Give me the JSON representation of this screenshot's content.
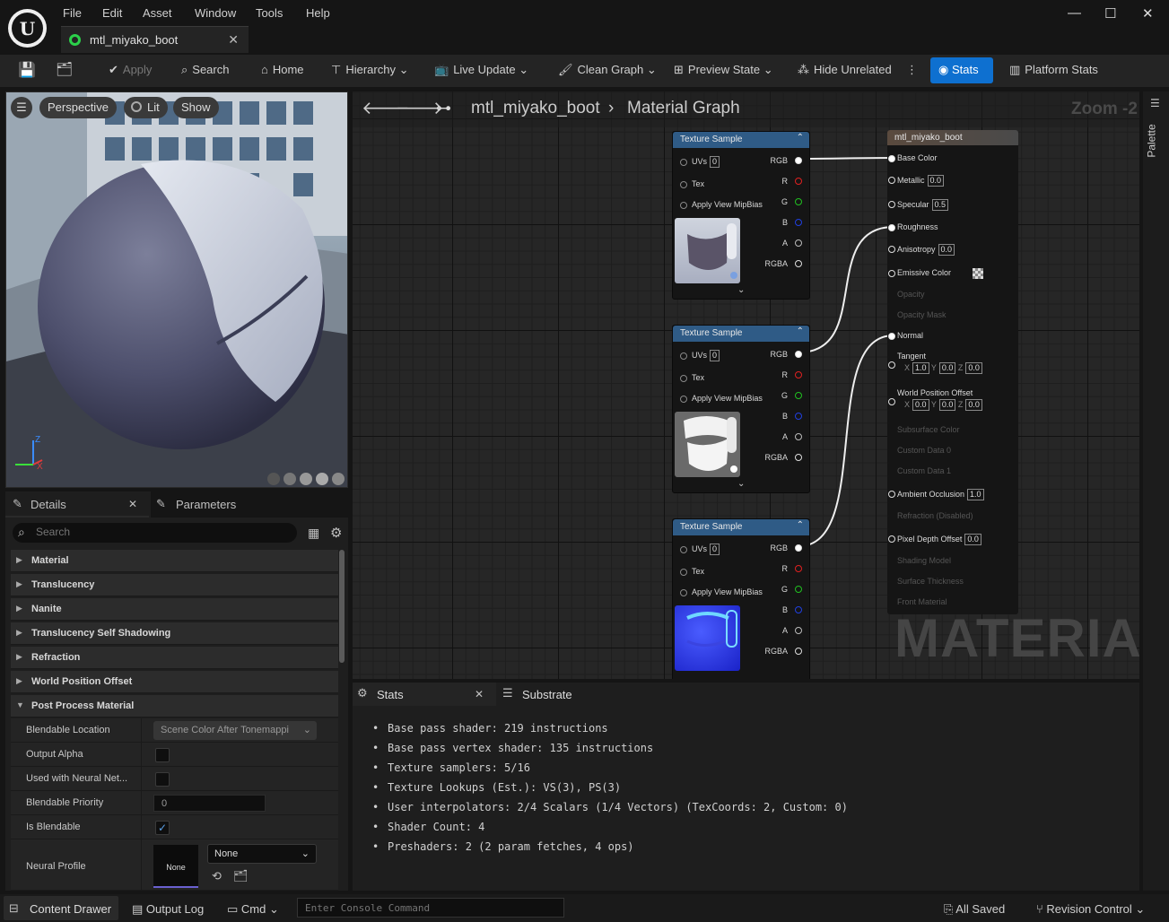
{
  "menu": [
    "File",
    "Edit",
    "Asset",
    "Window",
    "Tools",
    "Help"
  ],
  "document_tab": "mtl_miyako_boot",
  "toolbar": {
    "apply": "Apply",
    "search": "Search",
    "home": "Home",
    "hierarchy": "Hierarchy",
    "live_update": "Live Update",
    "clean_graph": "Clean Graph",
    "preview_state": "Preview State",
    "hide_unrelated": "Hide Unrelated",
    "stats": "Stats",
    "platform_stats": "Platform Stats"
  },
  "viewport": {
    "perspective": "Perspective",
    "lit": "Lit",
    "show": "Show",
    "axis_z": "Z",
    "axis_x": "X"
  },
  "details": {
    "tab_details": "Details",
    "tab_parameters": "Parameters",
    "search_placeholder": "Search",
    "sections": [
      "Material",
      "Translucency",
      "Nanite",
      "Translucency Self Shadowing",
      "Refraction",
      "World Position Offset",
      "Post Process Material"
    ],
    "post_process": {
      "blendable_location_label": "Blendable Location",
      "blendable_location_value": "Scene Color After Tonemappi",
      "output_alpha_label": "Output Alpha",
      "neural_net_label": "Used with Neural Net...",
      "blendable_priority_label": "Blendable Priority",
      "blendable_priority_value": "0",
      "is_blendable_label": "Is Blendable",
      "neural_profile_label": "Neural Profile",
      "neural_profile_thumb": "None",
      "neural_profile_value": "None"
    }
  },
  "graph": {
    "breadcrumb_asset": "mtl_miyako_boot",
    "breadcrumb_graph": "Material Graph",
    "zoom": "Zoom -2",
    "watermark": "MATERIAL",
    "texture_nodes": [
      {
        "title": "Texture Sample",
        "uvs": "UVs",
        "uv_val": "0",
        "tex": "Tex",
        "mip": "Apply View MipBias",
        "outputs": [
          "RGB",
          "R",
          "G",
          "B",
          "A",
          "RGBA"
        ]
      },
      {
        "title": "Texture Sample",
        "uvs": "UVs",
        "uv_val": "0",
        "tex": "Tex",
        "mip": "Apply View MipBias",
        "outputs": [
          "RGB",
          "R",
          "G",
          "B",
          "A",
          "RGBA"
        ]
      },
      {
        "title": "Texture Sample",
        "uvs": "UVs",
        "uv_val": "0",
        "tex": "Tex",
        "mip": "Apply View MipBias",
        "outputs": [
          "RGB",
          "R",
          "G",
          "B",
          "A",
          "RGBA"
        ]
      }
    ],
    "material_node": {
      "title": "mtl_miyako_boot",
      "base_color": "Base Color",
      "metallic": "Metallic",
      "metallic_val": "0.0",
      "specular": "Specular",
      "specular_val": "0.5",
      "roughness": "Roughness",
      "anisotropy": "Anisotropy",
      "anisotropy_val": "0.0",
      "emissive": "Emissive Color",
      "opacity": "Opacity",
      "opacity_mask": "Opacity Mask",
      "normal": "Normal",
      "tangent": "Tangent",
      "tangent_vals": [
        "1.0",
        "0.0",
        "0.0"
      ],
      "wpo": "World Position Offset",
      "wpo_vals": [
        "0.0",
        "0.0",
        "0.0"
      ],
      "xyz": [
        "X",
        "Y",
        "Z"
      ],
      "subsurface": "Subsurface Color",
      "custom0": "Custom Data 0",
      "custom1": "Custom Data 1",
      "ao": "Ambient Occlusion",
      "ao_val": "1.0",
      "refraction": "Refraction (Disabled)",
      "pdo": "Pixel Depth Offset",
      "pdo_val": "0.0",
      "shading_model": "Shading Model",
      "surface_thickness": "Surface Thickness",
      "front_material": "Front Material"
    }
  },
  "stats_panel": {
    "tab_stats": "Stats",
    "tab_substrate": "Substrate",
    "lines": [
      "Base pass shader: 219 instructions",
      "Base pass vertex shader: 135 instructions",
      "Texture samplers: 5/16",
      "Texture Lookups (Est.): VS(3), PS(3)",
      "User interpolators: 2/4 Scalars (1/4 Vectors) (TexCoords: 2, Custom: 0)",
      "Shader Count: 4",
      "Preshaders: 2  (2 param fetches, 4 ops)"
    ]
  },
  "palette_label": "Palette",
  "statusbar": {
    "content_drawer": "Content Drawer",
    "output_log": "Output Log",
    "cmd": "Cmd",
    "console_placeholder": "Enter Console Command",
    "all_saved": "All Saved",
    "revision_control": "Revision Control"
  },
  "colors": {
    "accent": "#0e70d0",
    "node_header": "#2f5b86",
    "pin_r": "#e02020",
    "pin_g": "#20c020",
    "pin_b": "#2040e0"
  }
}
